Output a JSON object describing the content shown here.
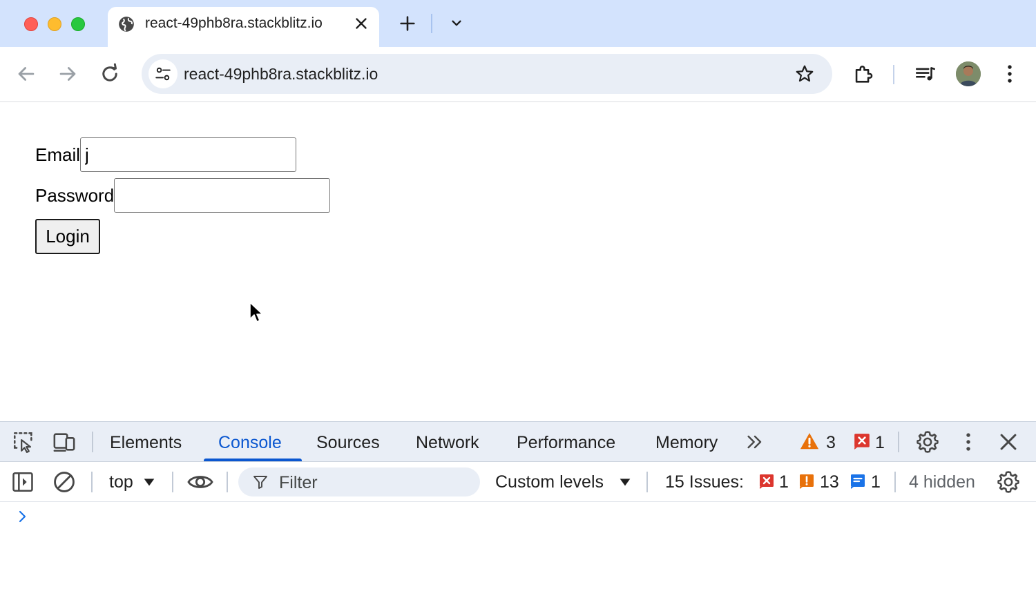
{
  "browser": {
    "tab": {
      "title": "react-49phb8ra.stackblitz.io"
    },
    "address_bar": {
      "url": "react-49phb8ra.stackblitz.io"
    }
  },
  "page": {
    "email": {
      "label": "Email",
      "value": "j"
    },
    "password": {
      "label": "Password",
      "value": ""
    },
    "login_button": {
      "label": "Login"
    }
  },
  "devtools": {
    "tabs": [
      {
        "label": "Elements"
      },
      {
        "label": "Console"
      },
      {
        "label": "Sources"
      },
      {
        "label": "Network"
      },
      {
        "label": "Performance"
      },
      {
        "label": "Memory"
      }
    ],
    "active_tab": "Console",
    "warning_count": "3",
    "error_count": "1",
    "console": {
      "context": "top",
      "filter_placeholder": "Filter",
      "levels": "Custom levels",
      "issues_label": "15 Issues:",
      "issues_errors": "1",
      "issues_warnings": "13",
      "issues_info": "1",
      "hidden_label": "4 hidden"
    }
  },
  "colors": {
    "tabstrip_bg": "#d3e3fd",
    "accent_blue": "#0b57d0",
    "warning_orange": "#e8710a",
    "error_red": "#dc362e",
    "info_blue": "#1a73e8"
  }
}
